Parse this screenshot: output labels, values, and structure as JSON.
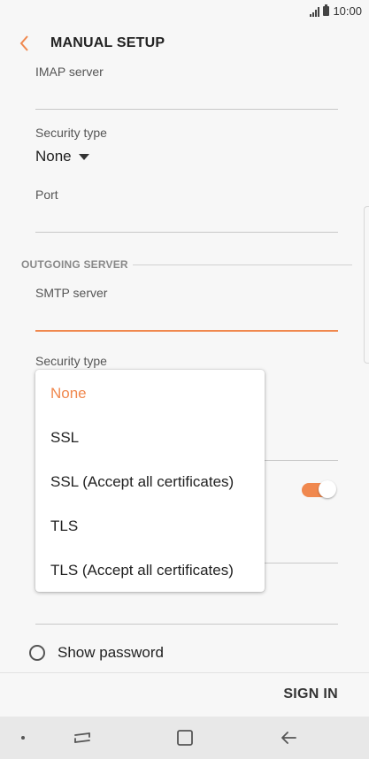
{
  "status_bar": {
    "time": "10:00"
  },
  "header": {
    "title": "MANUAL SETUP"
  },
  "incoming": {
    "imap_label": "IMAP server",
    "security_label": "Security type",
    "security_value": "None",
    "port_label": "Port"
  },
  "outgoing": {
    "section_title": "OUTGOING SERVER",
    "smtp_label": "SMTP server",
    "security_label": "Security type"
  },
  "dropdown": {
    "options": [
      "None",
      "SSL",
      "SSL (Accept all certificates)",
      "TLS",
      "TLS (Accept all certificates)"
    ],
    "selected": "None"
  },
  "show_password": {
    "label": "Show password",
    "checked": false
  },
  "toggle": {
    "on": true
  },
  "footer": {
    "sign_in": "SIGN IN"
  },
  "colors": {
    "accent": "#f0884e",
    "background": "#f7f7f7",
    "nav_bar": "#e8e8e8"
  },
  "icons": [
    "back-arrow-icon",
    "signal-icon",
    "battery-icon",
    "recent-apps-icon",
    "home-icon",
    "nav-back-icon"
  ]
}
